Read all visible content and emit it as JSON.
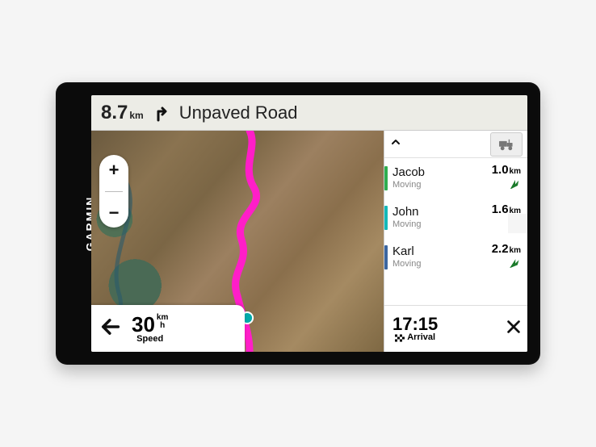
{
  "brand": "GARMIN",
  "nav": {
    "distance_value": "8.7",
    "distance_unit": "km",
    "turn_icon": "turn-right-icon",
    "road_name": "Unpaved Road"
  },
  "map": {
    "zoom_in_label": "+",
    "zoom_out_label": "−",
    "route_color": "#ff1ec8"
  },
  "speed": {
    "value": "30",
    "unit_top": "km",
    "unit_bottom": "h",
    "label": "Speed"
  },
  "panel": {
    "mode_icon": "offroad-vehicle-icon",
    "riders": [
      {
        "name": "Jacob",
        "status": "Moving",
        "distance_value": "1.0",
        "distance_unit": "km",
        "stripe_color": "#2fae4f",
        "bearing_deg": 35
      },
      {
        "name": "John",
        "status": "Moving",
        "distance_value": "1.6",
        "distance_unit": "km",
        "stripe_color": "#14b8b8",
        "bearing_deg": 30
      },
      {
        "name": "Karl",
        "status": "Moving",
        "distance_value": "2.2",
        "distance_unit": "km",
        "stripe_color": "#3b66a0",
        "bearing_deg": 30
      }
    ]
  },
  "arrival": {
    "time": "17:15",
    "label": "Arrival"
  }
}
